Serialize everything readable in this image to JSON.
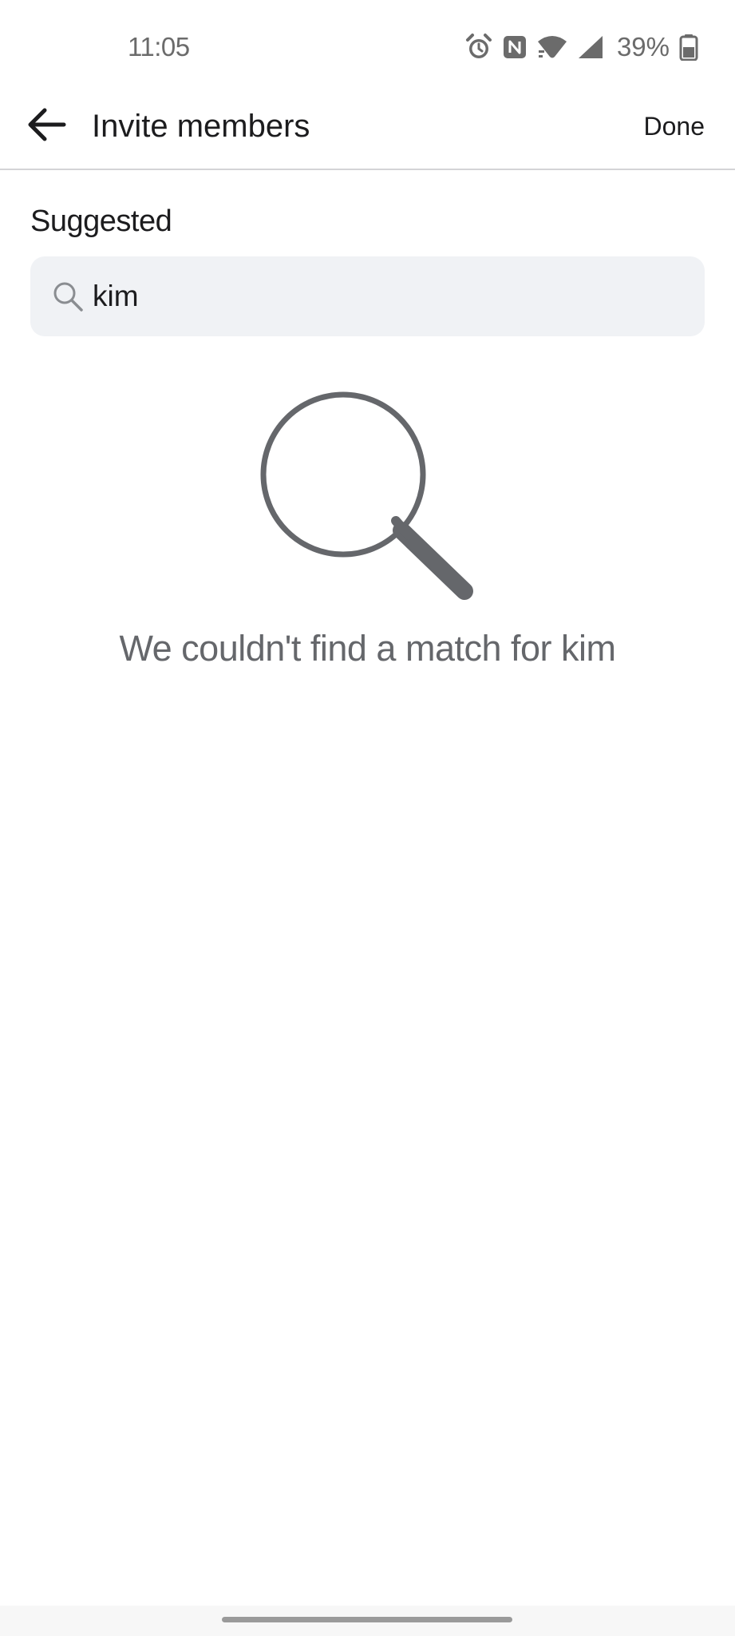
{
  "status_bar": {
    "time": "11:05",
    "battery_percent": "39%",
    "icons": [
      "alarm-icon",
      "nfc-icon",
      "wifi-icon",
      "cell-signal-icon",
      "battery-icon"
    ]
  },
  "header": {
    "title": "Invite members",
    "back_icon": "arrow-left-icon",
    "done_label": "Done"
  },
  "suggested": {
    "label": "Suggested"
  },
  "search": {
    "icon": "search-icon",
    "value": "kim"
  },
  "empty_state": {
    "illustration_icon": "magnifying-glass-icon",
    "message": "We couldn't find a match for kim",
    "color": "#65676b"
  },
  "colors": {
    "search_background": "#f0f2f5",
    "divider": "#d4d4d6",
    "text": "#1c1c1e"
  }
}
